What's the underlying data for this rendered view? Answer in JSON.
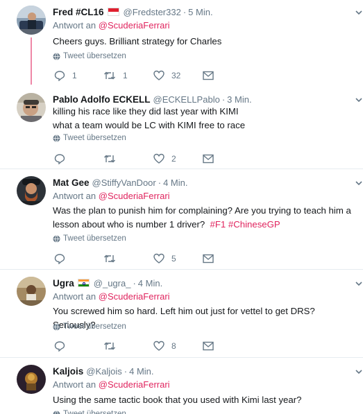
{
  "reply_prefix": "Antwort an",
  "reply_target": "@ScuderiaFerrari",
  "translate_label": "Tweet übersetzen",
  "tweets": [
    {
      "name": "Fred #CL16",
      "handle": "@Fredster332",
      "time": "5 Min.",
      "flag": "indonesia-flag",
      "is_reply": true,
      "lines": [
        "Cheers guys. Brilliant strategy for Charles"
      ],
      "replies": "1",
      "retweets": "1",
      "likes": "32"
    },
    {
      "name": "Pablo Adolfo ECKELL",
      "handle": "@ECKELLPablo",
      "time": "3 Min.",
      "is_reply": false,
      "lines": [
        "killing his race like they did last year with KIMI",
        "what a team would be LC with KIMI free to race"
      ],
      "replies": "",
      "retweets": "",
      "likes": "2"
    },
    {
      "name": "Mat Gee",
      "handle": "@StiffyVanDoor",
      "time": "4 Min.",
      "is_reply": true,
      "lines": [
        "Was the plan to punish him for complaining? Are you trying to teach him a",
        "lesson about who is number 1 driver?"
      ],
      "hashtags": [
        "#F1",
        "#ChineseGP"
      ],
      "replies": "",
      "retweets": "",
      "likes": "5"
    },
    {
      "name": "Ugra",
      "handle": "@_ugra_",
      "time": "4 Min.",
      "flag": "india-flag",
      "is_reply": true,
      "lines": [
        "You screwed him so hard. Left him out just for vettel to get DRS? Seriously?"
      ],
      "replies": "",
      "retweets": "",
      "likes": "8"
    },
    {
      "name": "Kaljois",
      "handle": "@Kaljois",
      "time": "4 Min.",
      "is_reply": true,
      "lines": [
        "Using the same tactic book that you used with Kimi last year?"
      ],
      "replies": "",
      "retweets": "",
      "likes": ""
    }
  ],
  "colors": {
    "accent": "#e0245e",
    "muted": "#657786",
    "text": "#14171a",
    "separator": "#e6ecf0"
  },
  "icons": {
    "reply": "reply-icon",
    "retweet": "retweet-icon",
    "like": "heart-icon",
    "dm": "envelope-icon",
    "menu": "chevron-down-icon",
    "translate": "globe-icon"
  }
}
